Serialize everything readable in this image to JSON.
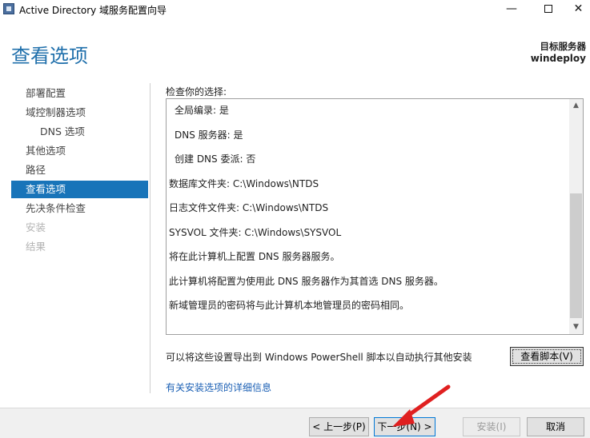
{
  "window": {
    "title": "Active Directory 域服务配置向导",
    "minimize_glyph": "—",
    "close_glyph": "✕"
  },
  "header": {
    "page_title": "查看选项",
    "target_label": "目标服务器",
    "target_name": "windeploy"
  },
  "nav": {
    "items": [
      {
        "label": "部署配置",
        "state": "normal"
      },
      {
        "label": "域控制器选项",
        "state": "normal"
      },
      {
        "label": "DNS 选项",
        "state": "sub"
      },
      {
        "label": "其他选项",
        "state": "normal"
      },
      {
        "label": "路径",
        "state": "normal"
      },
      {
        "label": "查看选项",
        "state": "active"
      },
      {
        "label": "先决条件检查",
        "state": "normal"
      },
      {
        "label": "安装",
        "state": "disabled"
      },
      {
        "label": "结果",
        "state": "disabled"
      }
    ]
  },
  "review": {
    "label": "检查你的选择:",
    "lines": [
      "全局编录: 是",
      "DNS 服务器: 是",
      "创建 DNS 委派: 否",
      "数据库文件夹: C:\\Windows\\NTDS",
      "日志文件文件夹: C:\\Windows\\NTDS",
      "SYSVOL 文件夹: C:\\Windows\\SYSVOL",
      "将在此计算机上配置 DNS 服务器服务。",
      "此计算机将配置为使用此 DNS 服务器作为其首选 DNS 服务器。",
      "新域管理员的密码将与此计算机本地管理员的密码相同。"
    ],
    "scroll_up_glyph": "▲",
    "scroll_down_glyph": "▼"
  },
  "export": {
    "text": "可以将这些设置导出到 Windows PowerShell 脚本以自动执行其他安装",
    "view_script_label": "查看脚本(V)"
  },
  "more_info_link": "有关安装选项的详细信息",
  "footer": {
    "prev_label": "< 上一步(P)",
    "next_label": "下一步(N) >",
    "install_label": "安装(I)",
    "cancel_label": "取消"
  },
  "colors": {
    "accent": "#1874b9",
    "title_blue": "#1f6fab",
    "annotation_red": "#e02020"
  }
}
